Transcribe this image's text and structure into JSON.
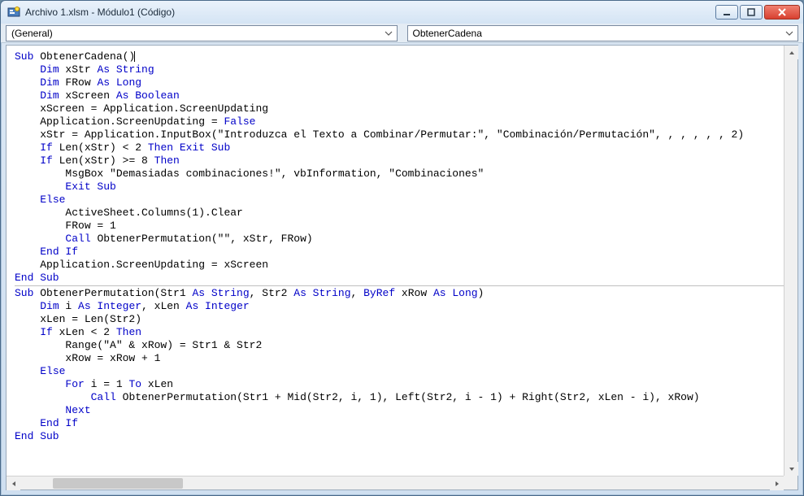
{
  "window": {
    "title": "Archivo 1.xlsm - Módulo1 (Código)"
  },
  "dropdowns": {
    "left": "(General)",
    "right": "ObtenerCadena"
  },
  "code": {
    "lines": [
      [
        [
          "kw",
          "Sub"
        ],
        [
          "p",
          " ObtenerCadena()"
        ]
      ],
      [
        [
          "p",
          "    "
        ],
        [
          "kw",
          "Dim"
        ],
        [
          "p",
          " xStr "
        ],
        [
          "kw",
          "As String"
        ]
      ],
      [
        [
          "p",
          "    "
        ],
        [
          "kw",
          "Dim"
        ],
        [
          "p",
          " FRow "
        ],
        [
          "kw",
          "As Long"
        ]
      ],
      [
        [
          "p",
          "    "
        ],
        [
          "kw",
          "Dim"
        ],
        [
          "p",
          " xScreen "
        ],
        [
          "kw",
          "As Boolean"
        ]
      ],
      [
        [
          "p",
          "    xScreen = Application.ScreenUpdating"
        ]
      ],
      [
        [
          "p",
          "    Application.ScreenUpdating = "
        ],
        [
          "kw",
          "False"
        ]
      ],
      [
        [
          "p",
          "    xStr = Application.InputBox(\"Introduzca el Texto a Combinar/Permutar:\", \"Combinación/Permutación\", , , , , , 2)"
        ]
      ],
      [
        [
          "p",
          "    "
        ],
        [
          "kw",
          "If"
        ],
        [
          "p",
          " Len(xStr) < 2 "
        ],
        [
          "kw",
          "Then Exit Sub"
        ]
      ],
      [
        [
          "p",
          "    "
        ],
        [
          "kw",
          "If"
        ],
        [
          "p",
          " Len(xStr) >= 8 "
        ],
        [
          "kw",
          "Then"
        ]
      ],
      [
        [
          "p",
          "        MsgBox \"Demasiadas combinaciones!\", vbInformation, \"Combinaciones\""
        ]
      ],
      [
        [
          "p",
          "        "
        ],
        [
          "kw",
          "Exit Sub"
        ]
      ],
      [
        [
          "p",
          "    "
        ],
        [
          "kw",
          "Else"
        ]
      ],
      [
        [
          "p",
          "        ActiveSheet.Columns(1).Clear"
        ]
      ],
      [
        [
          "p",
          "        FRow = 1"
        ]
      ],
      [
        [
          "p",
          "        "
        ],
        [
          "kw",
          "Call"
        ],
        [
          "p",
          " ObtenerPermutation(\"\", xStr, FRow)"
        ]
      ],
      [
        [
          "p",
          "    "
        ],
        [
          "kw",
          "End If"
        ]
      ],
      [
        [
          "p",
          "    Application.ScreenUpdating = xScreen"
        ]
      ],
      [
        [
          "kw",
          "End Sub"
        ]
      ]
    ],
    "lines2": [
      [
        [
          "kw",
          "Sub"
        ],
        [
          "p",
          " ObtenerPermutation(Str1 "
        ],
        [
          "kw",
          "As String"
        ],
        [
          "p",
          ", Str2 "
        ],
        [
          "kw",
          "As String"
        ],
        [
          "p",
          ", "
        ],
        [
          "kw",
          "ByRef"
        ],
        [
          "p",
          " xRow "
        ],
        [
          "kw",
          "As Long"
        ],
        [
          "p",
          ")"
        ]
      ],
      [
        [
          "p",
          "    "
        ],
        [
          "kw",
          "Dim"
        ],
        [
          "p",
          " i "
        ],
        [
          "kw",
          "As Integer"
        ],
        [
          "p",
          ", xLen "
        ],
        [
          "kw",
          "As Integer"
        ]
      ],
      [
        [
          "p",
          "    xLen = Len(Str2)"
        ]
      ],
      [
        [
          "p",
          "    "
        ],
        [
          "kw",
          "If"
        ],
        [
          "p",
          " xLen < 2 "
        ],
        [
          "kw",
          "Then"
        ]
      ],
      [
        [
          "p",
          "        Range(\"A\" & xRow) = Str1 & Str2"
        ]
      ],
      [
        [
          "p",
          "        xRow = xRow + 1"
        ]
      ],
      [
        [
          "p",
          "    "
        ],
        [
          "kw",
          "Else"
        ]
      ],
      [
        [
          "p",
          "        "
        ],
        [
          "kw",
          "For"
        ],
        [
          "p",
          " i = 1 "
        ],
        [
          "kw",
          "To"
        ],
        [
          "p",
          " xLen"
        ]
      ],
      [
        [
          "p",
          "            "
        ],
        [
          "kw",
          "Call"
        ],
        [
          "p",
          " ObtenerPermutation(Str1 + Mid(Str2, i, 1), Left(Str2, i - 1) + Right(Str2, xLen - i), xRow)"
        ]
      ],
      [
        [
          "p",
          "        "
        ],
        [
          "kw",
          "Next"
        ]
      ],
      [
        [
          "p",
          "    "
        ],
        [
          "kw",
          "End If"
        ]
      ],
      [
        [
          "kw",
          "End Sub"
        ]
      ]
    ]
  }
}
